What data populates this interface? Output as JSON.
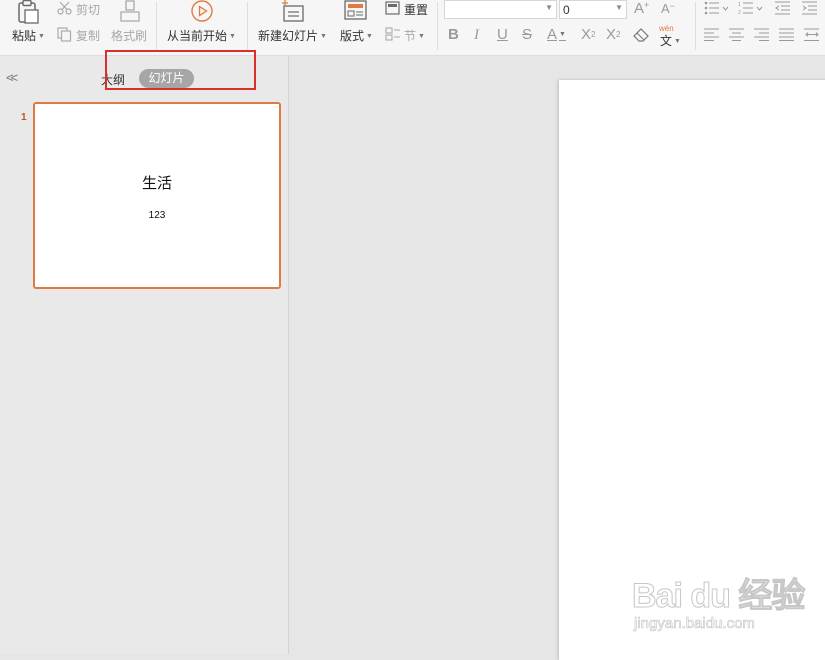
{
  "ribbon": {
    "paste_label": "粘贴",
    "cut_label": "剪切",
    "copy_label": "复制",
    "format_painter_label": "格式刷",
    "play_from_current_label": "从当前开始",
    "new_slide_label": "新建幻灯片",
    "layout_label": "版式",
    "reset_label": "重置",
    "section_label": "节",
    "font_size_value": "0",
    "phonetic_top": "wén",
    "phonetic_bottom": "文"
  },
  "panel": {
    "collapse_glyph": "<<",
    "tab_outline": "大纲",
    "tab_slides": "幻灯片"
  },
  "slides": [
    {
      "number": "1",
      "title": "生活",
      "subtitle": "123"
    }
  ],
  "watermark": {
    "main": "Bai du 经验",
    "sub": "jingyan.baidu.com"
  },
  "colors": {
    "accent": "#e07a42",
    "highlight": "#d9302a",
    "pill": "#a6a6a6"
  }
}
